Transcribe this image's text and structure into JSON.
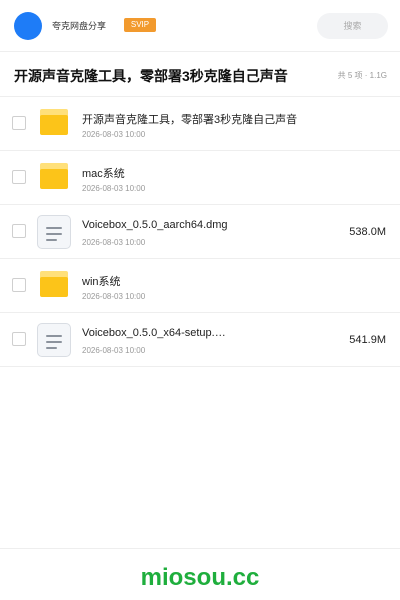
{
  "header": {
    "app_name": "夸克网盘分享",
    "badge": "SVIP",
    "search_placeholder": "搜索"
  },
  "share": {
    "title": "开源声音克隆工具，零部署3秒克隆自己声音",
    "meta": "共 5 项 · 1.1G"
  },
  "files": [
    {
      "type": "folder",
      "name": "开源声音克隆工具，零部署3秒克隆自己声音",
      "date": "2026-08-03 10:00",
      "size": ""
    },
    {
      "type": "folder",
      "name": "mac系统",
      "date": "2026-08-03 10:00",
      "size": ""
    },
    {
      "type": "file",
      "name": "Voicebox_0.5.0_aarch64.dmg",
      "date": "2026-08-03 10:00",
      "size": "538.0M"
    },
    {
      "type": "folder",
      "name": "win系统",
      "date": "2026-08-03 10:00",
      "size": ""
    },
    {
      "type": "file",
      "name": "Voicebox_0.5.0_x64-setup.…",
      "date": "2026-08-03 10:00",
      "size": "541.9M"
    }
  ],
  "footer": {
    "brand": "miosou.cc"
  },
  "colors": {
    "avatar": "#1e7cf7",
    "badge": "#f29a2e",
    "folder": "#fcc419",
    "brand": "#1fae3d"
  }
}
